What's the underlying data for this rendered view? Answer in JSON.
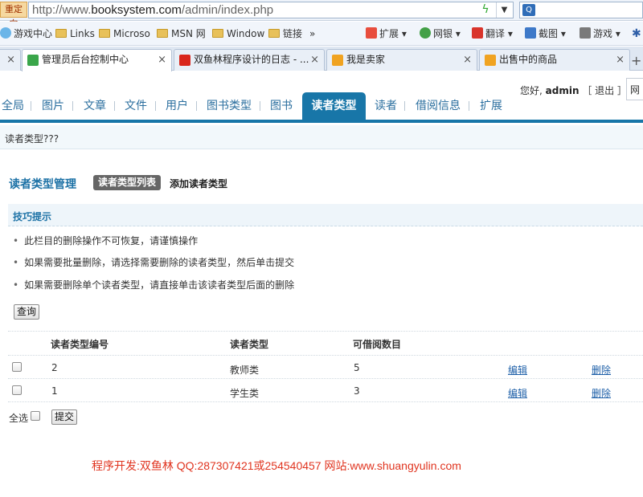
{
  "browser": {
    "redirect_tag": "重定向",
    "url_prefix": "http://www.",
    "url_domain": "booksystem.com",
    "url_path": "/admin/index.php",
    "search_placeholder": "",
    "favorites": [
      {
        "label": "游戏中心",
        "icon": "game-icon"
      },
      {
        "label": "Links",
        "icon": "folder-icon"
      },
      {
        "label": "Microso",
        "icon": "folder-icon"
      },
      {
        "label": "MSN 网",
        "icon": "folder-icon"
      },
      {
        "label": "Window",
        "icon": "folder-icon"
      },
      {
        "label": "链接",
        "icon": "folder-icon"
      },
      {
        "label": "»",
        "icon": ""
      }
    ],
    "tools": [
      {
        "label": "扩展",
        "color": "#e84d3d"
      },
      {
        "label": "网银",
        "color": "#43a047"
      },
      {
        "label": "翻译",
        "color": "#d9342b"
      },
      {
        "label": "截图",
        "color": "#3d79c9"
      },
      {
        "label": "游戏",
        "color": "#7a7a7a"
      }
    ],
    "tabs": [
      {
        "title": "管理员后台控制中心",
        "icon_color": "#3aa64a",
        "active": true
      },
      {
        "title": "双鱼林程序设计的日志 - ...",
        "icon_color": "#d9261c",
        "active": false
      },
      {
        "title": "我是卖家",
        "icon_color": "#f0a321",
        "active": false
      },
      {
        "title": "出售中的商品",
        "icon_color": "#f0a321",
        "active": false
      }
    ],
    "new_tab": "+"
  },
  "header": {
    "greeting": "您好,",
    "username": "admin",
    "logout": "［ 退出 ］",
    "site_clip": "网"
  },
  "nav": {
    "items": [
      "全局",
      "图片",
      "文章",
      "文件",
      "用户",
      "图书类型",
      "图书",
      "读者类型",
      "读者",
      "借阅信息",
      "扩展"
    ],
    "active": "读者类型"
  },
  "breadcrumb": "读者类型???",
  "manager": {
    "title": "读者类型管理",
    "list_tab": "读者类型列表",
    "add_link": "添加读者类型"
  },
  "tips": {
    "heading": "技巧提示",
    "items": [
      "此栏目的删除操作不可恢复，请谨慎操作",
      "如果需要批量删除，请选择需要删除的读者类型，然后单击提交",
      "如果需要删除单个读者类型，请直接单击该读者类型后面的删除"
    ]
  },
  "query_button": "查询",
  "table": {
    "headers": [
      "读者类型编号",
      "读者类型",
      "可借阅数目"
    ],
    "rows": [
      {
        "id": "2",
        "type": "教师类",
        "count": "5",
        "edit": "编辑",
        "delete": "删除"
      },
      {
        "id": "1",
        "type": "学生类",
        "count": "3",
        "edit": "编辑",
        "delete": "删除"
      }
    ]
  },
  "select_all": "全选",
  "submit_button": "提交",
  "footer": "程序开发:双鱼林 QQ:287307421或254540457 网站:www.shuangyulin.com",
  "colors": {
    "nav_blue": "#1876a8",
    "title_blue": "#1d72a6",
    "footer_red": "#e0341f"
  }
}
